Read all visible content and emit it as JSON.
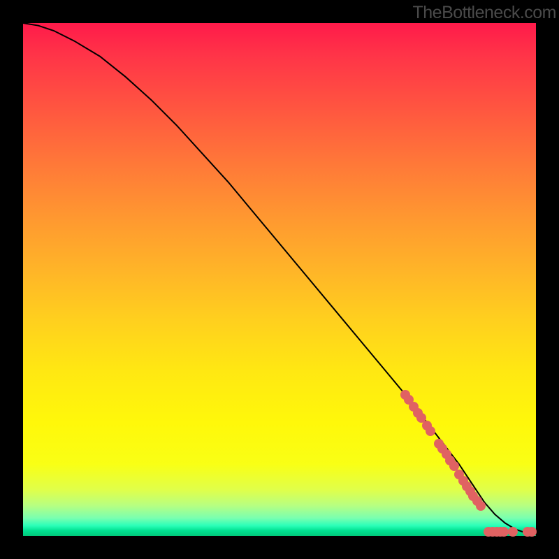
{
  "watermark": "TheBottleneck.com",
  "chart_data": {
    "type": "line",
    "title": "",
    "xlabel": "",
    "ylabel": "",
    "xlim": [
      0,
      100
    ],
    "ylim": [
      0,
      100
    ],
    "background": "rainbow-gradient",
    "curve": {
      "name": "bottleneck-curve",
      "x": [
        0,
        3,
        6,
        10,
        15,
        20,
        25,
        30,
        35,
        40,
        45,
        50,
        55,
        60,
        65,
        70,
        75,
        80,
        85,
        88,
        90,
        92,
        94,
        96,
        98,
        100
      ],
      "y": [
        100,
        99.5,
        98.5,
        96.5,
        93.5,
        89.5,
        85,
        80,
        74.5,
        69,
        63,
        57,
        51,
        45,
        39,
        33,
        27,
        20.5,
        14,
        9.5,
        6.5,
        4.2,
        2.5,
        1.3,
        0.6,
        0.3
      ]
    },
    "markers": [
      {
        "x": 74.5,
        "y": 27.5
      },
      {
        "x": 75.2,
        "y": 26.6
      },
      {
        "x": 76.2,
        "y": 25.2
      },
      {
        "x": 77.0,
        "y": 24.0
      },
      {
        "x": 77.7,
        "y": 23.0
      },
      {
        "x": 78.8,
        "y": 21.5
      },
      {
        "x": 79.4,
        "y": 20.5
      },
      {
        "x": 81.0,
        "y": 18.0
      },
      {
        "x": 81.8,
        "y": 17.0
      },
      {
        "x": 82.5,
        "y": 16.0
      },
      {
        "x": 83.3,
        "y": 14.7
      },
      {
        "x": 84.0,
        "y": 13.6
      },
      {
        "x": 85.0,
        "y": 12.0
      },
      {
        "x": 85.8,
        "y": 10.8
      },
      {
        "x": 86.5,
        "y": 9.7
      },
      {
        "x": 87.2,
        "y": 8.7
      },
      {
        "x": 87.8,
        "y": 7.8
      },
      {
        "x": 88.5,
        "y": 6.8
      },
      {
        "x": 89.2,
        "y": 5.8
      },
      {
        "x": 90.8,
        "y": 0.8
      },
      {
        "x": 91.6,
        "y": 0.8
      },
      {
        "x": 92.4,
        "y": 0.8
      },
      {
        "x": 93.0,
        "y": 0.8
      },
      {
        "x": 93.7,
        "y": 0.8
      },
      {
        "x": 95.5,
        "y": 0.8
      },
      {
        "x": 98.3,
        "y": 0.8
      },
      {
        "x": 99.2,
        "y": 0.8
      }
    ]
  }
}
